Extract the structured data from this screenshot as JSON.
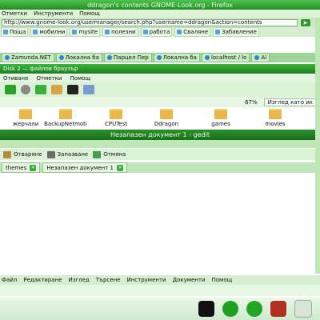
{
  "firefox": {
    "title": "ddragon's contents GNOME-Look.org - Firefox",
    "menu": [
      "Отметки",
      "Инструменти",
      "Помощ"
    ],
    "url": "http://www.gnome-look.org/usermanager/search.php?username=ddragon&action=contents",
    "bookmarks": [
      "Поща",
      "мобилни",
      "mysite",
      "полезни",
      "работа",
      "Сваляне",
      "Забавление"
    ],
    "tabs": [
      "Zamunda.NET",
      "Локална ба",
      "Парцел Пер",
      "Локална ба",
      "localhost / lo",
      "Al"
    ]
  },
  "filebrowser": {
    "title": "Disk 2 — файлов браузър",
    "menu": [
      "Отиване",
      "Отметки",
      "Помощ"
    ],
    "zoom": "67%",
    "view_mode": "Изглед като ик",
    "folders": [
      "жерчали",
      "BackupNetmoti",
      "CPUTest",
      "Ddragon",
      "games",
      "movies"
    ]
  },
  "gedit": {
    "title": "Незапазен документ 1 - gedit",
    "toolbar": {
      "open": "Отваряне",
      "save": "Запазване",
      "undo": "Отмяна"
    },
    "tabs": {
      "side": "themes",
      "doc": "Незапазен документ 1"
    },
    "menu": [
      "Файл",
      "Редактиране",
      "Изглед",
      "Търсене",
      "Инструменти",
      "Документи",
      "Помощ"
    ]
  },
  "colors": {
    "accent": "#2e9b2e",
    "folder": "#e8b84c"
  }
}
